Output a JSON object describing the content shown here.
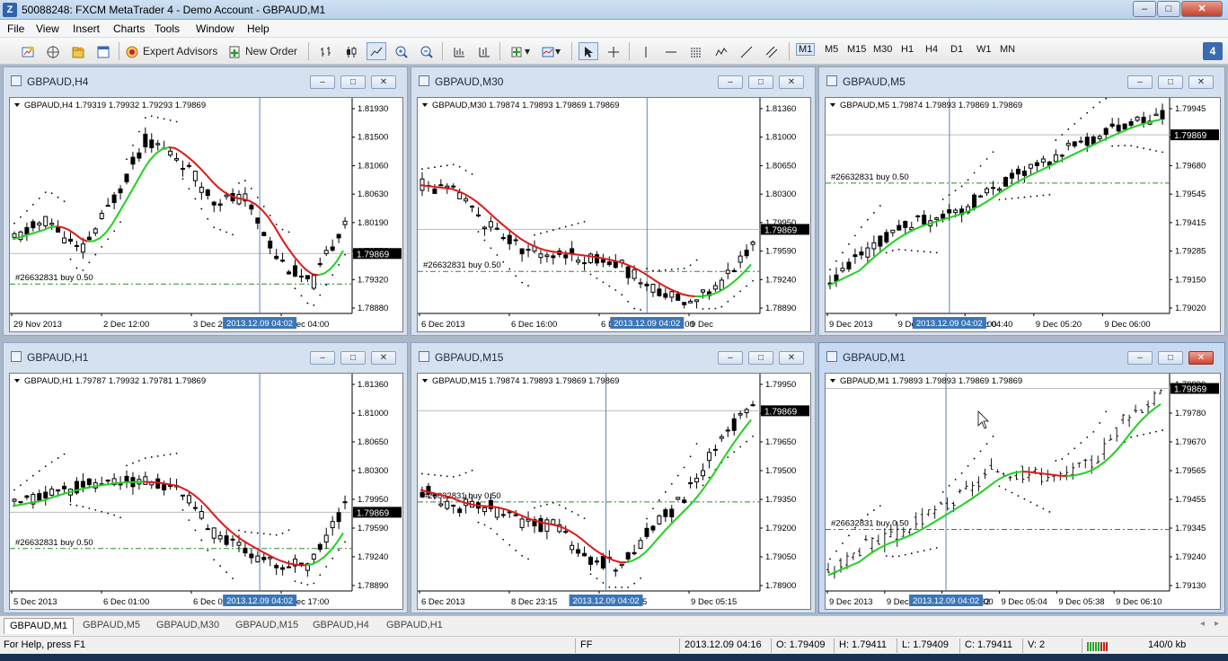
{
  "window": {
    "title": "50088248: FXCM MetaTrader 4 - Demo Account - GBPAUD,M1",
    "app_icon": "Z",
    "minimize": "–",
    "maximize": "□",
    "close": "✕"
  },
  "menu": [
    "File",
    "View",
    "Insert",
    "Charts",
    "Tools",
    "Window",
    "Help"
  ],
  "toolbar": {
    "expert_advisors": "Expert Advisors",
    "new_order": "New Order",
    "timeframes": [
      "M1",
      "M5",
      "M15",
      "M30",
      "H1",
      "H4",
      "D1",
      "W1",
      "MN"
    ],
    "active_timeframe": "M1",
    "notify_count": "4"
  },
  "charts": [
    {
      "id": "h4",
      "title": "GBPAUD,H4",
      "info": "GBPAUD,H4  1.79319 1.79932 1.79293 1.79869",
      "prices": [
        "1.81930",
        "1.81500",
        "1.81060",
        "1.80630",
        "1.80190",
        "1.79750",
        "1.79320",
        "1.78880"
      ],
      "current_price": "1.79869",
      "order_label": "#26632831 buy 0.50",
      "dates": [
        "29 Nov 2013",
        "2 Dec 12:00",
        "3 Dec 20:00",
        "5 Dec 04:00"
      ],
      "cursor_date": "2013.12.09 04:02",
      "active": false
    },
    {
      "id": "m30",
      "title": "GBPAUD,M30",
      "info": "GBPAUD,M30  1.79874 1.79893 1.79869 1.79869",
      "prices": [
        "1.81360",
        "1.81000",
        "1.80650",
        "1.80300",
        "1.79950",
        "1.79590",
        "1.79240",
        "1.78890"
      ],
      "current_price": "1.79869",
      "order_label": "#26632831 buy 0.50",
      "dates": [
        "6 Dec 2013",
        "6 Dec 16:00",
        "6 Dec 20:00",
        "9 Dec"
      ],
      "cursor_date": "2013.12.09 04:02",
      "date_tail": "00",
      "active": false
    },
    {
      "id": "m5",
      "title": "GBPAUD,M5",
      "info": "GBPAUD,M5  1.79874 1.79893 1.79869 1.79869",
      "prices": [
        "1.79945",
        "1.79810",
        "1.79680",
        "1.79545",
        "1.79415",
        "1.79285",
        "1.79150",
        "1.79020"
      ],
      "current_price": "1.79869",
      "order_label": "#26632831 buy 0.50",
      "dates": [
        "9 Dec 2013",
        "9 Dec",
        "9 Dec 04:40",
        "9 Dec 05:20",
        "9 Dec 06:00"
      ],
      "cursor_date": "2013.12.09 04:02",
      "date_tail": "00",
      "active": false
    },
    {
      "id": "h1",
      "title": "GBPAUD,H1",
      "info": "GBPAUD,H1  1.79787 1.79932 1.79781 1.79869",
      "prices": [
        "1.81360",
        "1.81000",
        "1.80650",
        "1.80300",
        "1.79950",
        "1.79590",
        "1.79240",
        "1.78890"
      ],
      "current_price": "1.79869",
      "order_label": "#26632831 buy 0.50",
      "dates": [
        "5 Dec 2013",
        "6 Dec 01:00",
        "6 Dec 09:00",
        "6 Dec 17:00"
      ],
      "cursor_date": "2013.12.09 04:02",
      "active": false
    },
    {
      "id": "m15",
      "title": "GBPAUD,M15",
      "info": "GBPAUD,M15  1.79874 1.79893 1.79869 1.79869",
      "prices": [
        "1.79950",
        "1.79800",
        "1.79650",
        "1.79500",
        "1.79350",
        "1.79200",
        "1.79050",
        "1.78900"
      ],
      "current_price": "1.79869",
      "order_label": "#26632831 buy 0.50",
      "dates": [
        "6 Dec 2013",
        "8 Dec 23:15",
        "9 Dec 01:15",
        "9 Dec 05:15"
      ],
      "cursor_date": "2013.12.09 04:02",
      "active": false
    },
    {
      "id": "m1",
      "title": "GBPAUD,M1",
      "info": "GBPAUD,M1  1.79893 1.79893 1.79869 1.79869",
      "prices": [
        "1.79890",
        "1.79780",
        "1.79670",
        "1.79565",
        "1.79455",
        "1.79345",
        "1.79240",
        "1.79130"
      ],
      "current_price": "1.79869",
      "order_label": "#26632831 buy 0.50",
      "dates": [
        "9 Dec 2013",
        "9 Dec",
        "9 Dec 04:32",
        "9 Dec 05:04",
        "9 Dec 05:38",
        "9 Dec 06:10"
      ],
      "cursor_date": "2013.12.09 04:02",
      "date_tail": "00",
      "active": true
    }
  ],
  "tabs": [
    "GBPAUD,M1",
    "GBPAUD,M5",
    "GBPAUD,M30",
    "GBPAUD,M15",
    "GBPAUD,H4",
    "GBPAUD,H1"
  ],
  "active_tab": "GBPAUD,M1",
  "status": {
    "help": "For Help, press F1",
    "profile": "FF",
    "datetime": "2013.12.09 04:16",
    "open": "O: 1.79409",
    "high": "H: 1.79411",
    "low": "L: 1.79409",
    "close": "C: 1.79411",
    "volume": "V: 2",
    "traffic": "140/0 kb"
  },
  "colors": {
    "bear_fill": "#000000",
    "bull_fill": "#ffffff",
    "ma_down": "#e01818",
    "ma_up": "#22d022",
    "order_line": "#2a8a2a",
    "cursor_line": "#5a86b4",
    "price_tag_bg": "#000000"
  }
}
